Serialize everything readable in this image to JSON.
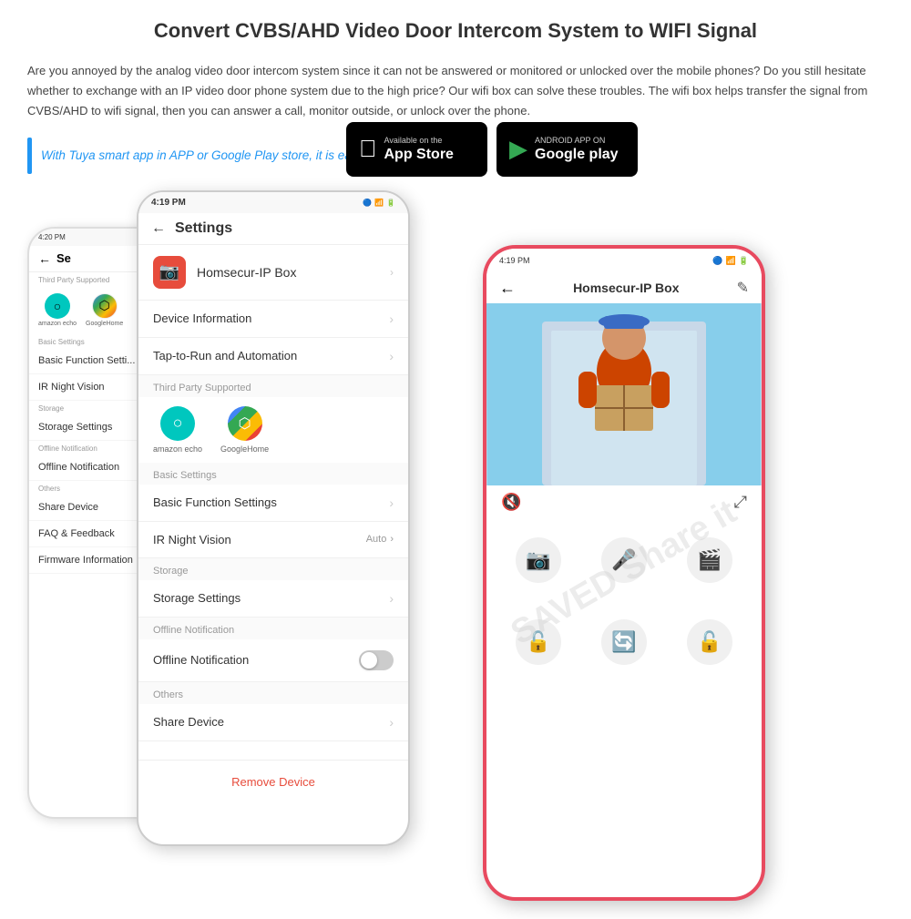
{
  "title": "Convert CVBS/AHD Video Door Intercom System to WIFI Signal",
  "description": "Are you annoyed by the analog video door intercom system since it can not be answered or monitored or unlocked over the mobile phones? Do you still hesitate whether to exchange with an IP video door phone system due to the high price? Our wifi box can solve these troubles. The wifi box helps transfer the signal from CVBS/AHD to wifi signal, then you can answer a call, monitor outside, or unlock over the phone.",
  "highlight": "With Tuya smart app in APP or Google Play store, it is easy to operate.",
  "app_store": {
    "ios_small": "Available on the",
    "ios_store": "App Store",
    "android_small": "ANDROID APP ON",
    "android_store": "Google play"
  },
  "front_phone": {
    "time": "4:19 PM",
    "title": "Settings",
    "item1_name": "Homsecur-IP Box",
    "section1": "Device Information",
    "section2": "Tap-to-Run and Automation",
    "third_party_section": "Third Party Supported",
    "tp1": "amazon echo",
    "tp2": "GoogleHome",
    "basic_section": "Basic Settings",
    "basic1": "Basic Function Settings",
    "basic2": "IR Night Vision",
    "basic2_val": "Auto",
    "storage_section": "Storage",
    "storage1": "Storage Settings",
    "offline_section": "Offline Notification",
    "offline1": "Offline Notification",
    "others_section": "Others",
    "others1": "Share Device",
    "remove": "Remove Device"
  },
  "back_phone": {
    "time": "4:20 PM",
    "title": "Se",
    "tp_section": "Third Party Supported",
    "tp1": "amazon echo",
    "tp2": "GoogleHome",
    "basic_section": "Basic Settings",
    "basic1": "Basic Function Setti...",
    "basic2": "IR Night Vision",
    "storage_section": "Storage",
    "storage1": "Storage Settings",
    "offline_section": "Offline Notification",
    "offline1": "Offline Notification",
    "others_section": "Others",
    "others1": "Share Device",
    "others2": "FAQ & Feedback",
    "others3": "Firmware Information"
  },
  "right_phone": {
    "time": "4:19 PM",
    "title": "Homsecur-IP Box",
    "ctrl_photo": "📷",
    "ctrl_mic": "🎤",
    "ctrl_video": "📹",
    "ctrl_lock1": "🔓",
    "ctrl_sync": "🔄",
    "ctrl_lock2": "🔓"
  },
  "watermark": "SAVED\nShare it"
}
